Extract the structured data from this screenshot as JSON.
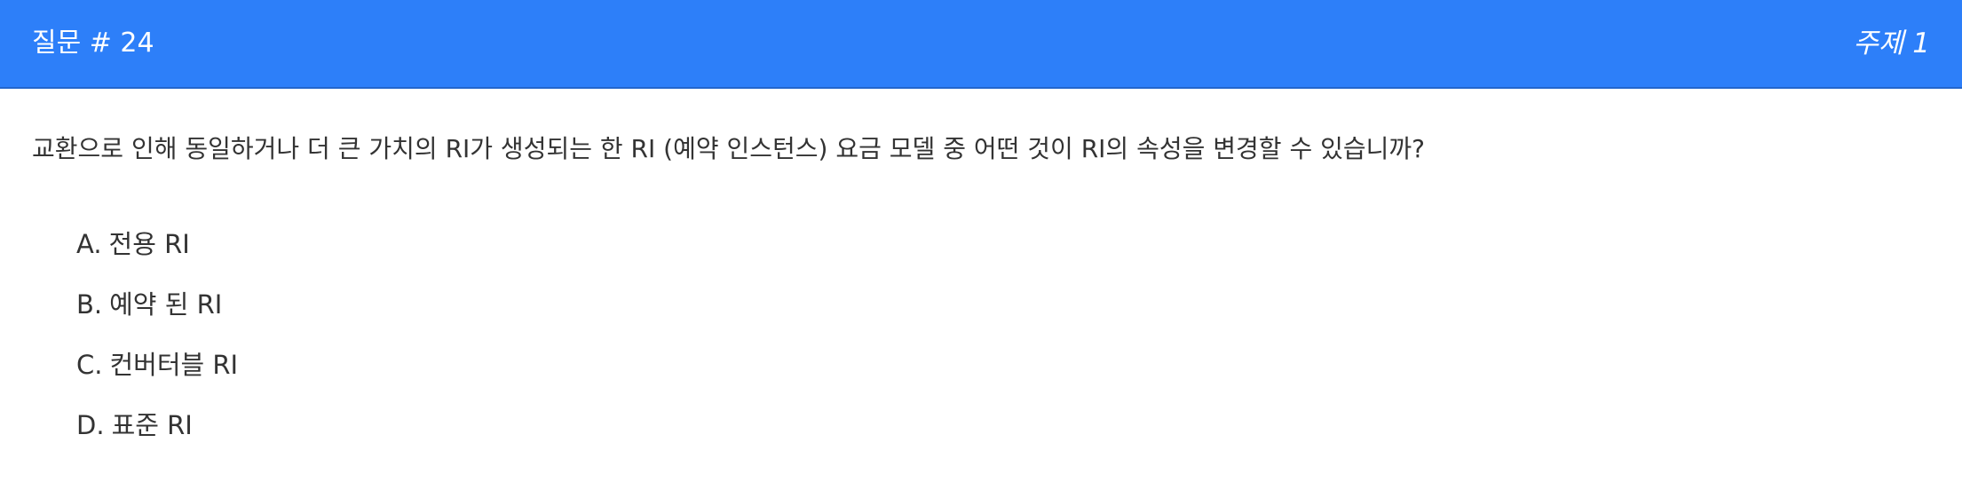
{
  "header": {
    "title": "질문 # 24",
    "topic": "주제 1",
    "background_color": "#2d7ff9"
  },
  "question": {
    "text": "교환으로 인해 동일하거나 더 큰 가치의 RI가 생성되는 한 RI (예약 인스턴스) 요금 모델 중 어떤 것이 RI의 속성을 변경할 수 있습니까?"
  },
  "options": [
    {
      "letter": "A.",
      "text": "전용 RI"
    },
    {
      "letter": "B.",
      "text": "예약 된 RI"
    },
    {
      "letter": "C.",
      "text": "컨버터블 RI"
    },
    {
      "letter": "D.",
      "text": "표준 RI"
    }
  ]
}
